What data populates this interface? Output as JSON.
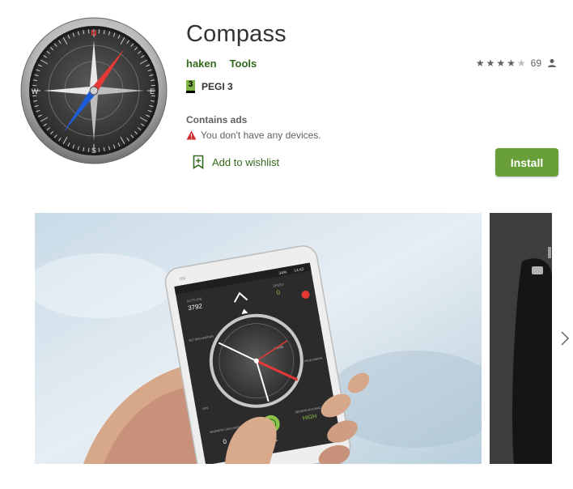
{
  "app": {
    "title": "Compass",
    "developer": "haken",
    "category": "Tools",
    "pegi_number": "3",
    "pegi_label": "PEGI 3",
    "contains_ads": "Contains ads",
    "device_warning": "You don't have any devices.",
    "wishlist_label": "Add to wishlist",
    "install_label": "Install"
  },
  "rating": {
    "stars": 4,
    "max_stars": 5,
    "count": "69"
  },
  "compass_icon": {
    "letters": {
      "north": "N",
      "east": "E",
      "south": "S",
      "west": "W"
    }
  },
  "screenshot": {
    "brand": "mi",
    "time": "14:42",
    "battery": "34%",
    "altitude_label": "ALTITUDE",
    "altitude_value": "3792",
    "speed_label": "SPEED",
    "speed_value": "0",
    "magnetic_label": "MAGNETIC DECLINATION",
    "magnetic_value": "0",
    "angle_value": "11.7°",
    "accuracy_label": "SENSOR ACCURACY",
    "accuracy_value": "HIGH",
    "true_north_label": "TRUE NORTH",
    "dec_label": "SET DECLINATION",
    "gps_label": "GPS",
    "home_label": "HOME"
  },
  "colors": {
    "accent_green": "#689f38",
    "link_green": "#33691e",
    "warning_red": "#d32f2f",
    "pegi_green": "#7cb342",
    "needle_red": "#e53935",
    "needle_blue": "#1e5bd6"
  },
  "icons": {
    "rating_user": "person-icon",
    "warning": "warning-triangle-icon",
    "wishlist": "bookmark-add-icon",
    "carousel_next": "chevron-right-icon"
  }
}
